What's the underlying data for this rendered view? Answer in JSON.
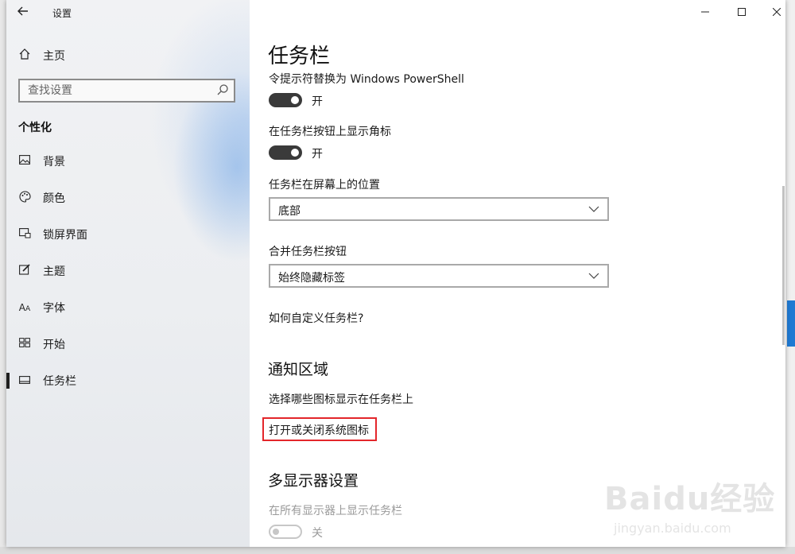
{
  "window": {
    "title": "设置"
  },
  "sidebar": {
    "home": "主页",
    "search_placeholder": "查找设置",
    "section": "个性化",
    "items": [
      {
        "label": "背景",
        "icon": "picture-icon"
      },
      {
        "label": "颜色",
        "icon": "palette-icon"
      },
      {
        "label": "锁屏界面",
        "icon": "lock-screen-icon"
      },
      {
        "label": "主题",
        "icon": "theme-brush-icon"
      },
      {
        "label": "字体",
        "icon": "font-icon"
      },
      {
        "label": "开始",
        "icon": "start-grid-icon"
      },
      {
        "label": "任务栏",
        "icon": "taskbar-icon",
        "active": true
      }
    ]
  },
  "content": {
    "page_title": "任务栏",
    "setting_powershell": "令提示符替换为 Windows PowerShell",
    "toggle_powershell": "开",
    "setting_badges": "在任务栏按钮上显示角标",
    "toggle_badges": "开",
    "position_label": "任务栏在屏幕上的位置",
    "position_value": "底部",
    "combine_label": "合并任务栏按钮",
    "combine_value": "始终隐藏标签",
    "customize_link": "如何自定义任务栏?",
    "notify_heading": "通知区域",
    "notify_select_icons": "选择哪些图标显示在任务栏上",
    "notify_system_icons": "打开或关闭系统图标",
    "multi_heading": "多显示器设置",
    "multi_show_all": "在所有显示器上显示任务栏",
    "toggle_multi": "关"
  },
  "watermark": {
    "brand": "Baidu经验",
    "url": "jingyan.baidu.com"
  },
  "colors": {
    "accent_toggle": "#3a3a3a",
    "highlight_box": "#e3262b"
  }
}
